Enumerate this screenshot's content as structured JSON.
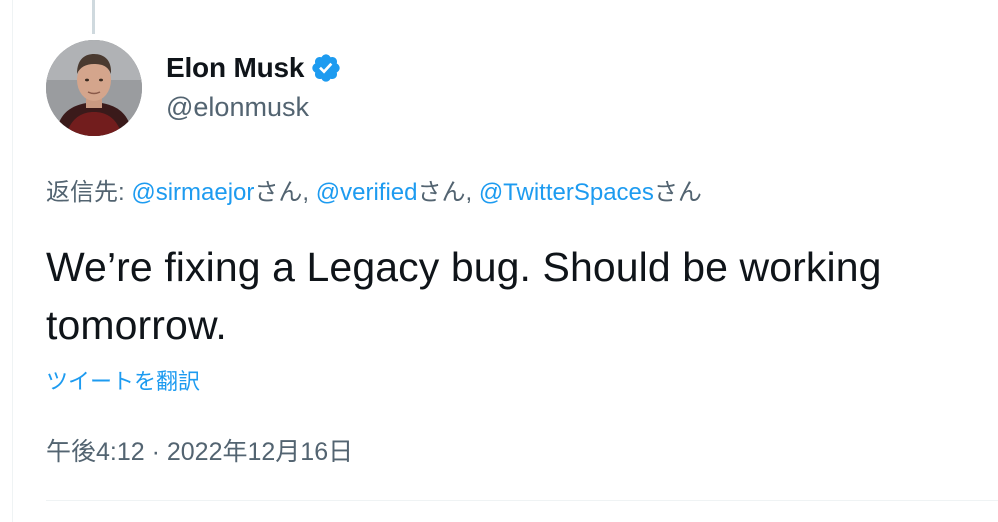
{
  "tweet": {
    "author": {
      "name": "Elon Musk",
      "handle": "@elonmusk",
      "verified": true
    },
    "reply_prefix": "返信先: ",
    "reply_mentions": [
      {
        "handle": "@sirmaejor",
        "suffix": "さん, "
      },
      {
        "handle": "@verified",
        "suffix": "さん, "
      },
      {
        "handle": "@TwitterSpaces",
        "suffix": "さん"
      }
    ],
    "text": "We’re fixing a Legacy bug. Should be working tomorrow.",
    "translate_label": "ツイートを翻訳",
    "timestamp": "午後4:12 · 2022年12月16日"
  },
  "colors": {
    "link": "#1d9bf0",
    "secondary_text": "#536471",
    "primary_text": "#0f1419"
  }
}
